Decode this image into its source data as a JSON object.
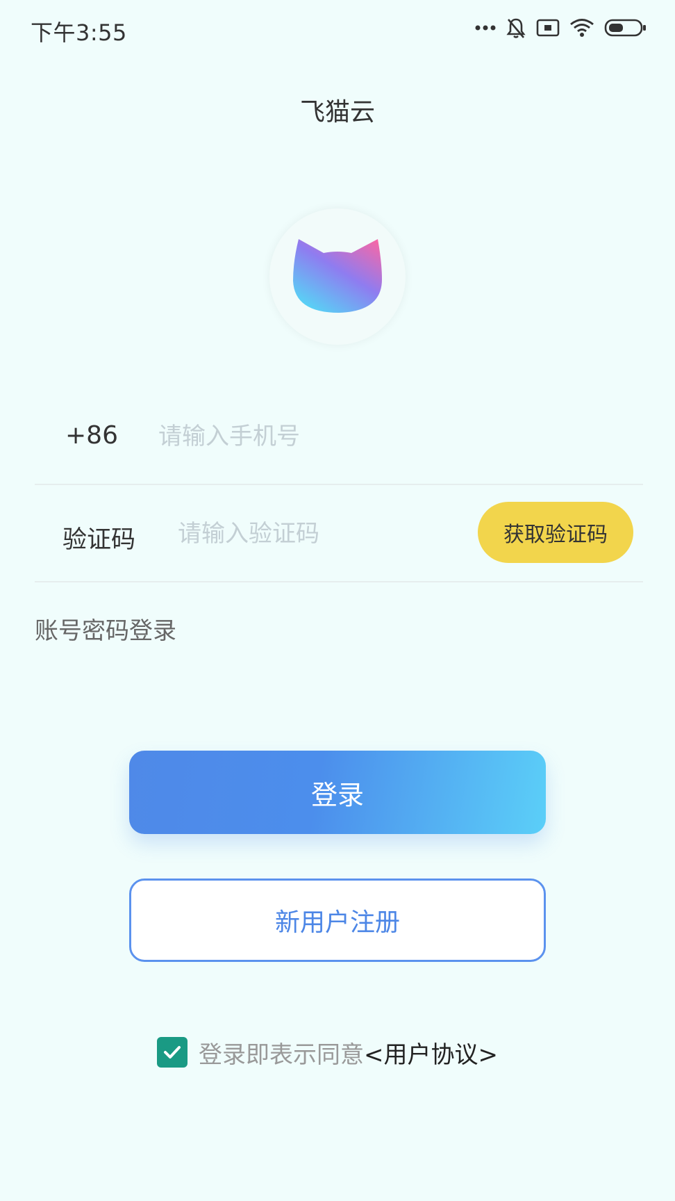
{
  "status_bar": {
    "time": "下午3:55",
    "icons": [
      "more-dots-icon",
      "mute-bell-icon",
      "sim-icon",
      "wifi-icon",
      "battery-icon"
    ]
  },
  "header": {
    "title": "飞猫云"
  },
  "logo": {
    "icon": "cat-head-logo",
    "colors": [
      "#5bd6f6",
      "#9a6cf0",
      "#f06ab0"
    ]
  },
  "form": {
    "phone": {
      "prefix": "+86",
      "placeholder": "请输入手机号",
      "value": ""
    },
    "code": {
      "label": "验证码",
      "placeholder": "请输入验证码",
      "value": "",
      "button_label": "获取验证码",
      "button_color": "#f2d54c"
    },
    "alt_login_label": "账号密码登录"
  },
  "actions": {
    "login_label": "登录",
    "register_label": "新用户注册",
    "accent_color": "#4f89e8"
  },
  "agreement": {
    "checked": true,
    "text": "登录即表示同意",
    "link": "<用户协议>",
    "checkbox_color": "#1a9a84"
  }
}
